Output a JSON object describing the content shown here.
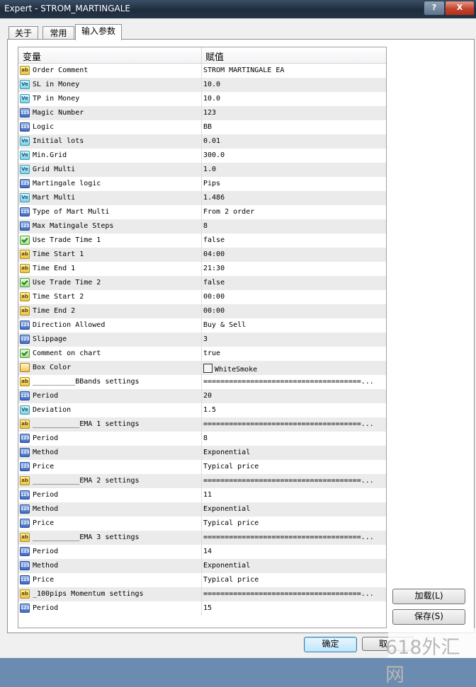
{
  "window": {
    "title": "Expert - STROM_MARTINGALE",
    "help_label": "?",
    "close_label": "X"
  },
  "tabs": [
    {
      "label": "关于",
      "active": false
    },
    {
      "label": "常用",
      "active": false
    },
    {
      "label": "输入参数",
      "active": true
    }
  ],
  "grid": {
    "columns": {
      "variable": "变量",
      "value": "赋值"
    },
    "rows": [
      {
        "icon": "ab",
        "name": "Order Comment",
        "value": "STROM MARTINGALE EA"
      },
      {
        "icon": "ve",
        "name": "SL in Money",
        "value": "10.0"
      },
      {
        "icon": "ve",
        "name": "TP in Money",
        "value": "10.0"
      },
      {
        "icon": "123",
        "name": "Magic Number",
        "value": "123"
      },
      {
        "icon": "123",
        "name": "Logic",
        "value": "BB"
      },
      {
        "icon": "ve",
        "name": "Initial lots",
        "value": "0.01"
      },
      {
        "icon": "ve",
        "name": "Min.Grid",
        "value": "300.0"
      },
      {
        "icon": "ve",
        "name": "Grid Multi",
        "value": "1.0"
      },
      {
        "icon": "123",
        "name": "Martingale logic",
        "value": "Pips"
      },
      {
        "icon": "ve",
        "name": "Mart Multi",
        "value": "1.486"
      },
      {
        "icon": "123",
        "name": "Type of Mart Multi",
        "value": "From 2 order"
      },
      {
        "icon": "123",
        "name": "Max Matingale Steps",
        "value": "8"
      },
      {
        "icon": "bool",
        "name": "Use Trade Time 1",
        "value": "false"
      },
      {
        "icon": "ab",
        "name": "Time Start 1",
        "value": "04:00"
      },
      {
        "icon": "ab",
        "name": "Time End 1",
        "value": "21:30"
      },
      {
        "icon": "bool",
        "name": "Use Trade Time 2",
        "value": "false"
      },
      {
        "icon": "ab",
        "name": "Time Start 2",
        "value": "00:00"
      },
      {
        "icon": "ab",
        "name": "Time End 2",
        "value": "00:00"
      },
      {
        "icon": "123",
        "name": "Direction Allowed",
        "value": "Buy & Sell"
      },
      {
        "icon": "123",
        "name": "Slippage",
        "value": "3"
      },
      {
        "icon": "bool",
        "name": "Comment on chart",
        "value": "true"
      },
      {
        "icon": "color",
        "name": "Box Color",
        "value": "WhiteSmoke",
        "swatch": "#f5f5f5"
      },
      {
        "icon": "ab",
        "name": "__________BBands settings",
        "value": "=====================================..."
      },
      {
        "icon": "123",
        "name": "Period",
        "value": "20"
      },
      {
        "icon": "ve",
        "name": "Deviation",
        "value": "1.5"
      },
      {
        "icon": "ab",
        "name": "___________EMA 1 settings",
        "value": "=====================================..."
      },
      {
        "icon": "123",
        "name": "Period",
        "value": "8"
      },
      {
        "icon": "123",
        "name": "Method",
        "value": "Exponential"
      },
      {
        "icon": "123",
        "name": "Price",
        "value": "Typical price"
      },
      {
        "icon": "ab",
        "name": "___________EMA 2 settings",
        "value": "=====================================..."
      },
      {
        "icon": "123",
        "name": "Period",
        "value": "11"
      },
      {
        "icon": "123",
        "name": "Method",
        "value": "Exponential"
      },
      {
        "icon": "123",
        "name": "Price",
        "value": "Typical price"
      },
      {
        "icon": "ab",
        "name": "___________EMA 3 settings",
        "value": "=====================================..."
      },
      {
        "icon": "123",
        "name": "Period",
        "value": "14"
      },
      {
        "icon": "123",
        "name": "Method",
        "value": "Exponential"
      },
      {
        "icon": "123",
        "name": "Price",
        "value": "Typical price"
      },
      {
        "icon": "ab",
        "name": "_100pips Momentum settings",
        "value": "=====================================..."
      },
      {
        "icon": "123",
        "name": "Period",
        "value": "15"
      }
    ]
  },
  "buttons": {
    "load": "加载(L)",
    "save": "保存(S)",
    "ok": "确定",
    "cancel": "取"
  },
  "watermark": "618外汇网"
}
